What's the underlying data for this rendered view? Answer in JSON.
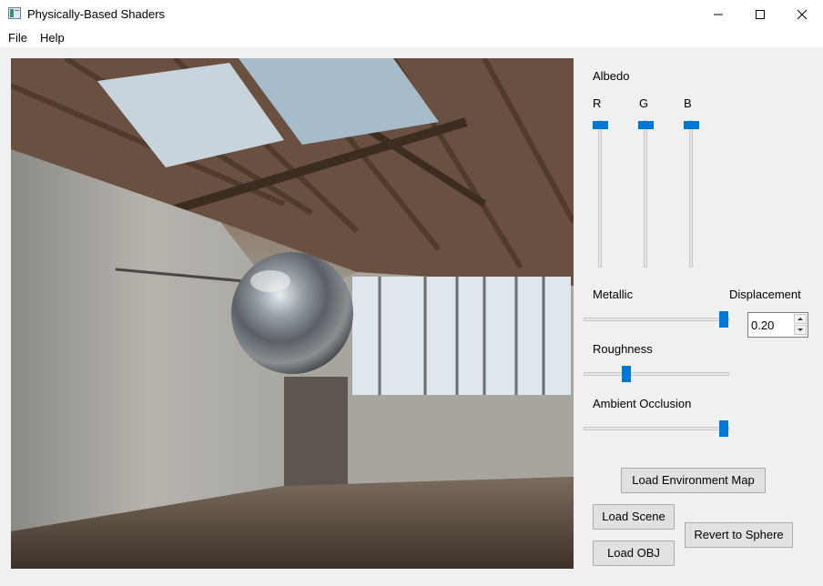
{
  "window": {
    "title": "Physically-Based Shaders",
    "minimize_icon": "minimize-icon",
    "maximize_icon": "maximize-icon",
    "close_icon": "close-icon"
  },
  "menu": {
    "items": [
      "File",
      "Help"
    ]
  },
  "viewport": {
    "content": "3D render of a reflective metallic sphere in a loft with skylights"
  },
  "controls": {
    "albedo": {
      "label": "Albedo",
      "channels": [
        {
          "label": "R",
          "value": 1.0
        },
        {
          "label": "G",
          "value": 1.0
        },
        {
          "label": "B",
          "value": 1.0
        }
      ]
    },
    "metallic": {
      "label": "Metallic",
      "value": 1.0
    },
    "displacement": {
      "label": "Displacement",
      "value": "0.20"
    },
    "roughness": {
      "label": "Roughness",
      "value": 0.3
    },
    "ambient_occlusion": {
      "label": "Ambient Occlusion",
      "value": 1.0
    }
  },
  "buttons": {
    "load_env_map": "Load Environment Map",
    "load_scene": "Load Scene",
    "load_obj": "Load OBJ",
    "revert_sphere": "Revert to Sphere"
  },
  "colors": {
    "accent": "#0078d7",
    "window_bg": "#f0f0f0"
  }
}
